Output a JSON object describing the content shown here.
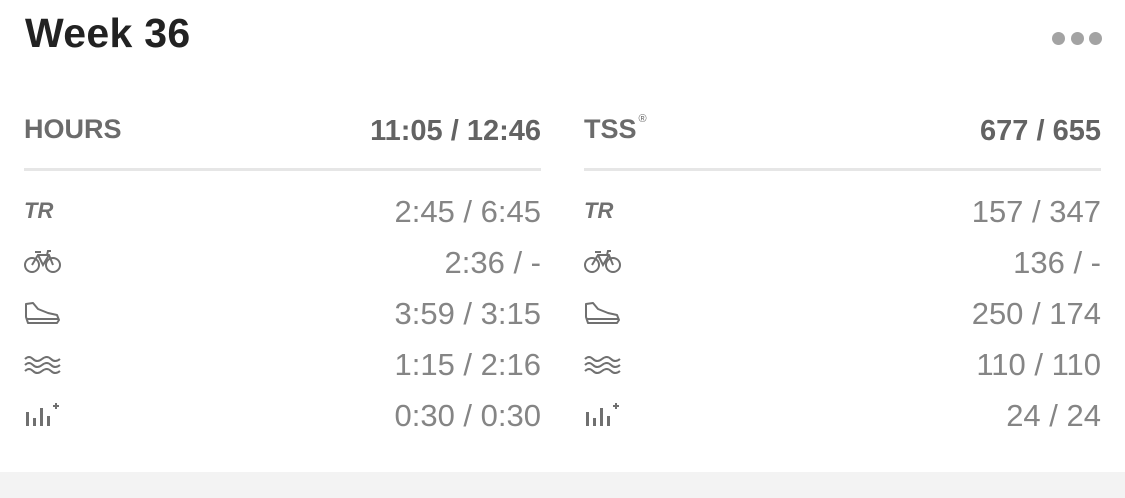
{
  "title": "Week 36",
  "hours": {
    "label": "HOURS",
    "total": "11:05 / 12:46",
    "rows": [
      {
        "icon": "trainerroad-logo-icon",
        "value": "2:45 / 6:45"
      },
      {
        "icon": "bike-icon",
        "value": "2:36 / -"
      },
      {
        "icon": "run-shoe-icon",
        "value": "3:59 / 3:15"
      },
      {
        "icon": "swim-waves-icon",
        "value": "1:15 / 2:16"
      },
      {
        "icon": "other-activity-icon",
        "value": "0:30 / 0:30"
      }
    ]
  },
  "tss": {
    "label": "TSS",
    "label_mark": "®",
    "total": "677 / 655",
    "rows": [
      {
        "icon": "trainerroad-logo-icon",
        "value": "157 / 347"
      },
      {
        "icon": "bike-icon",
        "value": "136 / -"
      },
      {
        "icon": "run-shoe-icon",
        "value": "250 / 174"
      },
      {
        "icon": "swim-waves-icon",
        "value": "110 / 110"
      },
      {
        "icon": "other-activity-icon",
        "value": "24 / 24"
      }
    ]
  },
  "colors": {
    "title": "#222222",
    "text": "#858585",
    "header": "#636363",
    "divider": "#e6e6e6",
    "icon": "#707070",
    "footer": "#f3f3f3"
  }
}
